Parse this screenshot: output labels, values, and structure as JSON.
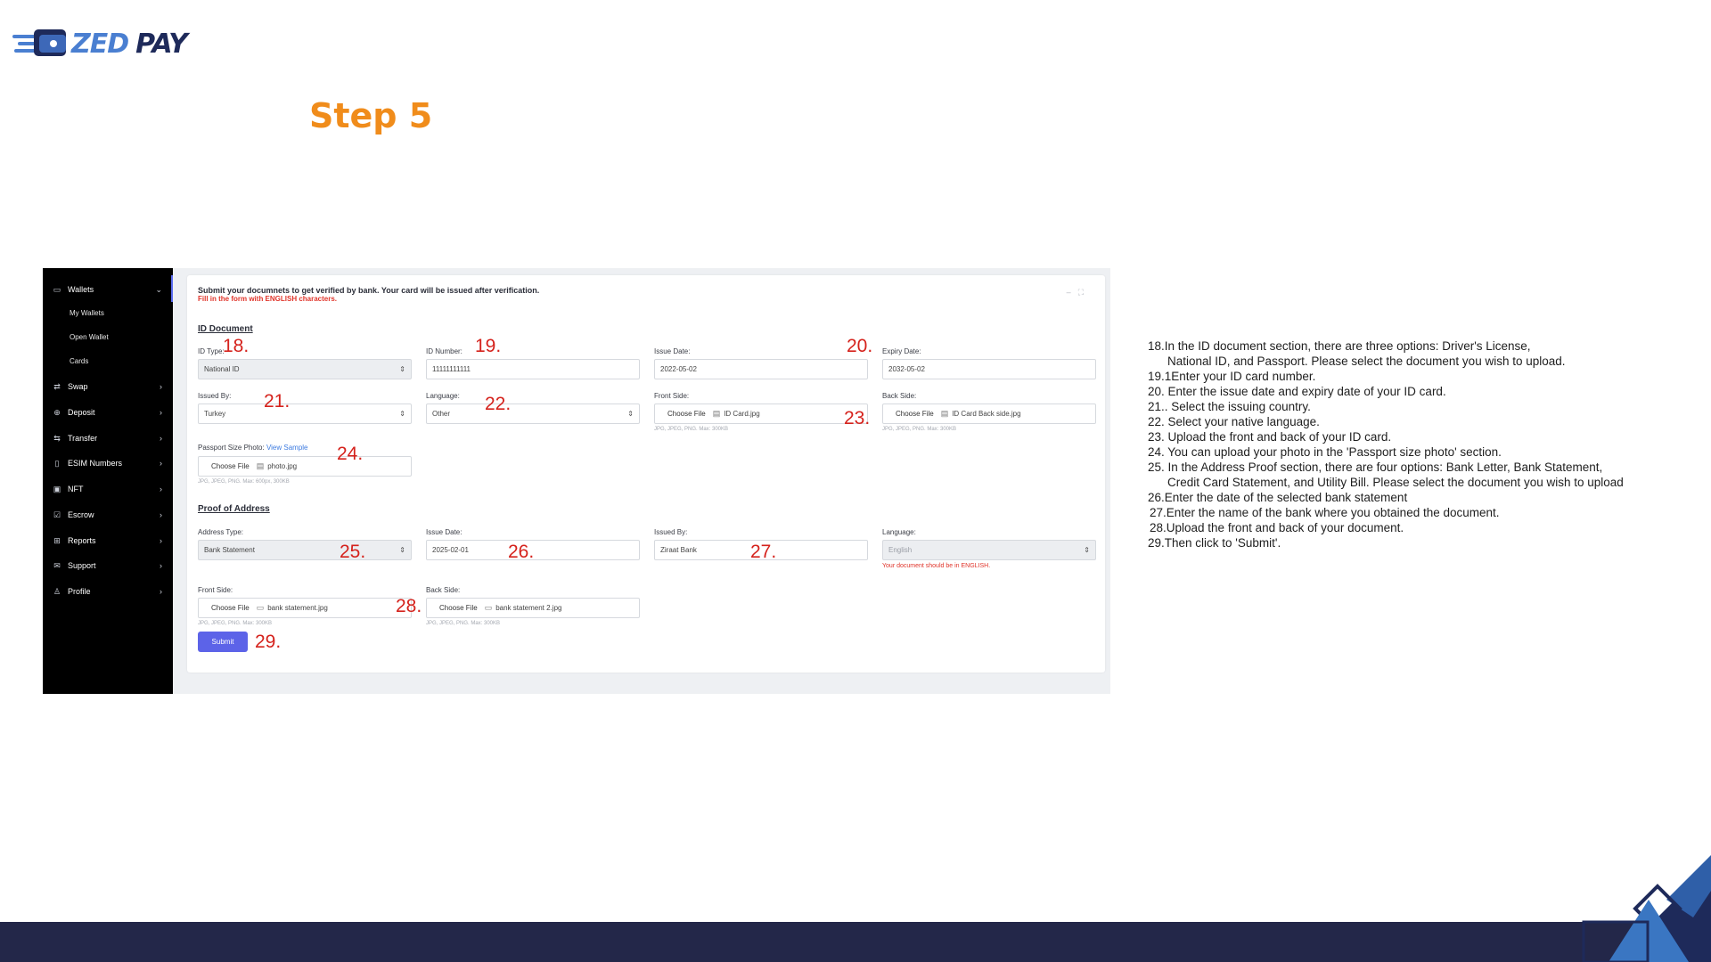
{
  "brand": {
    "zed": "ZED",
    "pay": "PAY"
  },
  "step_title": "Step 5",
  "sidebar": {
    "items": [
      {
        "label": "Wallets",
        "icon": "wallet-icon",
        "expanded": true
      },
      {
        "label": "Swap",
        "icon": "swap-icon"
      },
      {
        "label": "Deposit",
        "icon": "deposit-icon"
      },
      {
        "label": "Transfer",
        "icon": "transfer-icon"
      },
      {
        "label": "ESIM Numbers",
        "icon": "sim-icon"
      },
      {
        "label": "NFT",
        "icon": "nft-icon"
      },
      {
        "label": "Escrow",
        "icon": "escrow-icon"
      },
      {
        "label": "Reports",
        "icon": "reports-icon"
      },
      {
        "label": "Support",
        "icon": "support-icon"
      },
      {
        "label": "Profile",
        "icon": "profile-icon"
      }
    ],
    "subitems": [
      "My Wallets",
      "Open Wallet",
      "Cards"
    ]
  },
  "card": {
    "notice": "Submit your documnets to get verified by bank. Your card will be issued after verification.",
    "warning": "Fill in the form with ENGLISH characters.",
    "id_section": {
      "title": "ID Document",
      "id_type": {
        "label": "ID Type:",
        "value": "National ID"
      },
      "id_number": {
        "label": "ID Number:",
        "value": "11111111111"
      },
      "issue_date": {
        "label": "Issue Date:",
        "value": "2022-05-02"
      },
      "expiry_date": {
        "label": "Expiry Date:",
        "value": "2032-05-02"
      },
      "issued_by": {
        "label": "Issued By:",
        "value": "Turkey"
      },
      "language": {
        "label": "Language:",
        "value": "Other"
      },
      "front_side": {
        "label": "Front Side:",
        "button": "Choose File",
        "file": "ID Card.jpg",
        "hint": "JPG, JPEG, PNG. Max: 300KB"
      },
      "back_side": {
        "label": "Back Side:",
        "button": "Choose File",
        "file": "ID Card Back side.jpg",
        "hint": "JPG, JPEG, PNG. Max: 300KB"
      },
      "passport_photo": {
        "label": "Passport Size Photo:",
        "link": "View Sample",
        "button": "Choose File",
        "file": "photo.jpg",
        "hint": "JPG, JPEG, PNG. Max: 600px, 300KB"
      }
    },
    "address_section": {
      "title": "Proof of Address",
      "address_type": {
        "label": "Address Type:",
        "value": "Bank Statement"
      },
      "issue_date": {
        "label": "Issue Date:",
        "value": "2025-02-01"
      },
      "issued_by": {
        "label": "Issued By:",
        "value": "Ziraat Bank"
      },
      "language": {
        "label": "Language:",
        "value": "English",
        "error": "Your document should be in ENGLISH."
      },
      "front_side": {
        "label": "Front Side:",
        "button": "Choose File",
        "file": "bank statement.jpg",
        "hint": "JPG, JPEG, PNG. Max: 300KB"
      },
      "back_side": {
        "label": "Back Side:",
        "button": "Choose File",
        "file": "bank statement 2.jpg",
        "hint": "JPG, JPEG, PNG. Max: 300KB"
      }
    },
    "submit_label": "Submit"
  },
  "markers": [
    "18.",
    "19.",
    "20.",
    "21.",
    "22.",
    "23.",
    "24.",
    "25.",
    "26.",
    "27.",
    "28.",
    "29."
  ],
  "instructions": [
    "18.In the ID document section, there are three options: Driver's License,",
    "National ID, and Passport. Please select the document you wish to upload.",
    "19.1Enter your ID card number.",
    "20. Enter the issue date and expiry date of your ID card.",
    "21.. Select the issuing country.",
    "22. Select your native language.",
    "23. Upload the front and back of your ID card.",
    "24. You can upload your photo in the 'Passport size photo' section.",
    "25. In the Address Proof section, there are four options: Bank Letter, Bank Statement,",
    "Credit Card Statement, and Utility Bill. Please select the document you wish to upload",
    "26.Enter the date of the selected bank statement",
    "27.Enter the name of the bank where you obtained the document.",
    "28.Upload the front and back of your document.",
    "29.Then click to 'Submit'."
  ],
  "colors": {
    "accent_orange": "#f08c1b",
    "marker_red": "#d5221c",
    "submit": "#5c63e8",
    "footer": "#232749"
  }
}
